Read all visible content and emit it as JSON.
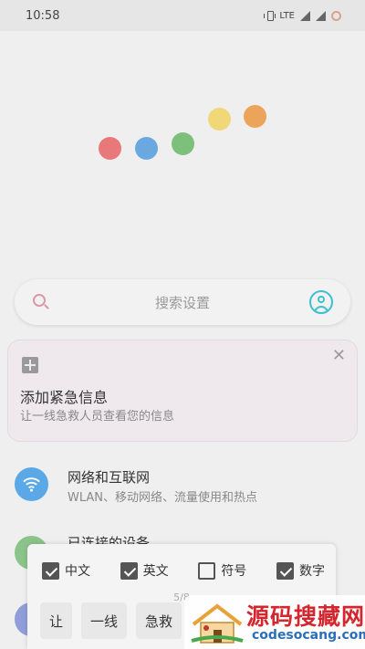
{
  "status_bar": {
    "time": "10:58",
    "network": "LTE"
  },
  "loading_dots": {
    "colors": [
      "#e9787a",
      "#6aa8e0",
      "#7cc07c",
      "#f0d878",
      "#eba45a"
    ]
  },
  "search": {
    "placeholder": "搜索设置"
  },
  "emergency_card": {
    "title": "添加紧急信息",
    "subtitle": "让一线急救人员查看您的信息"
  },
  "settings": [
    {
      "title": "网络和互联网",
      "subtitle": "WLAN、移动网络、流量使用和热点",
      "icon": "wifi-icon",
      "color": "#5aa9e6"
    },
    {
      "title": "已连接的设备",
      "subtitle": "",
      "icon": "devices-icon",
      "color": "#8bc48a"
    },
    {
      "title": "",
      "subtitle": "",
      "icon": "apps-icon",
      "color": "#8f9ed8"
    }
  ],
  "keyboard": {
    "options": [
      {
        "label": "中文",
        "checked": true
      },
      {
        "label": "英文",
        "checked": true
      },
      {
        "label": "符号",
        "checked": false
      },
      {
        "label": "数字",
        "checked": true
      }
    ],
    "page": "5/8",
    "suggestions": [
      "让",
      "一线",
      "急救"
    ]
  },
  "watermark": {
    "title": "源码搜藏网",
    "domain": "codesocang.com"
  }
}
